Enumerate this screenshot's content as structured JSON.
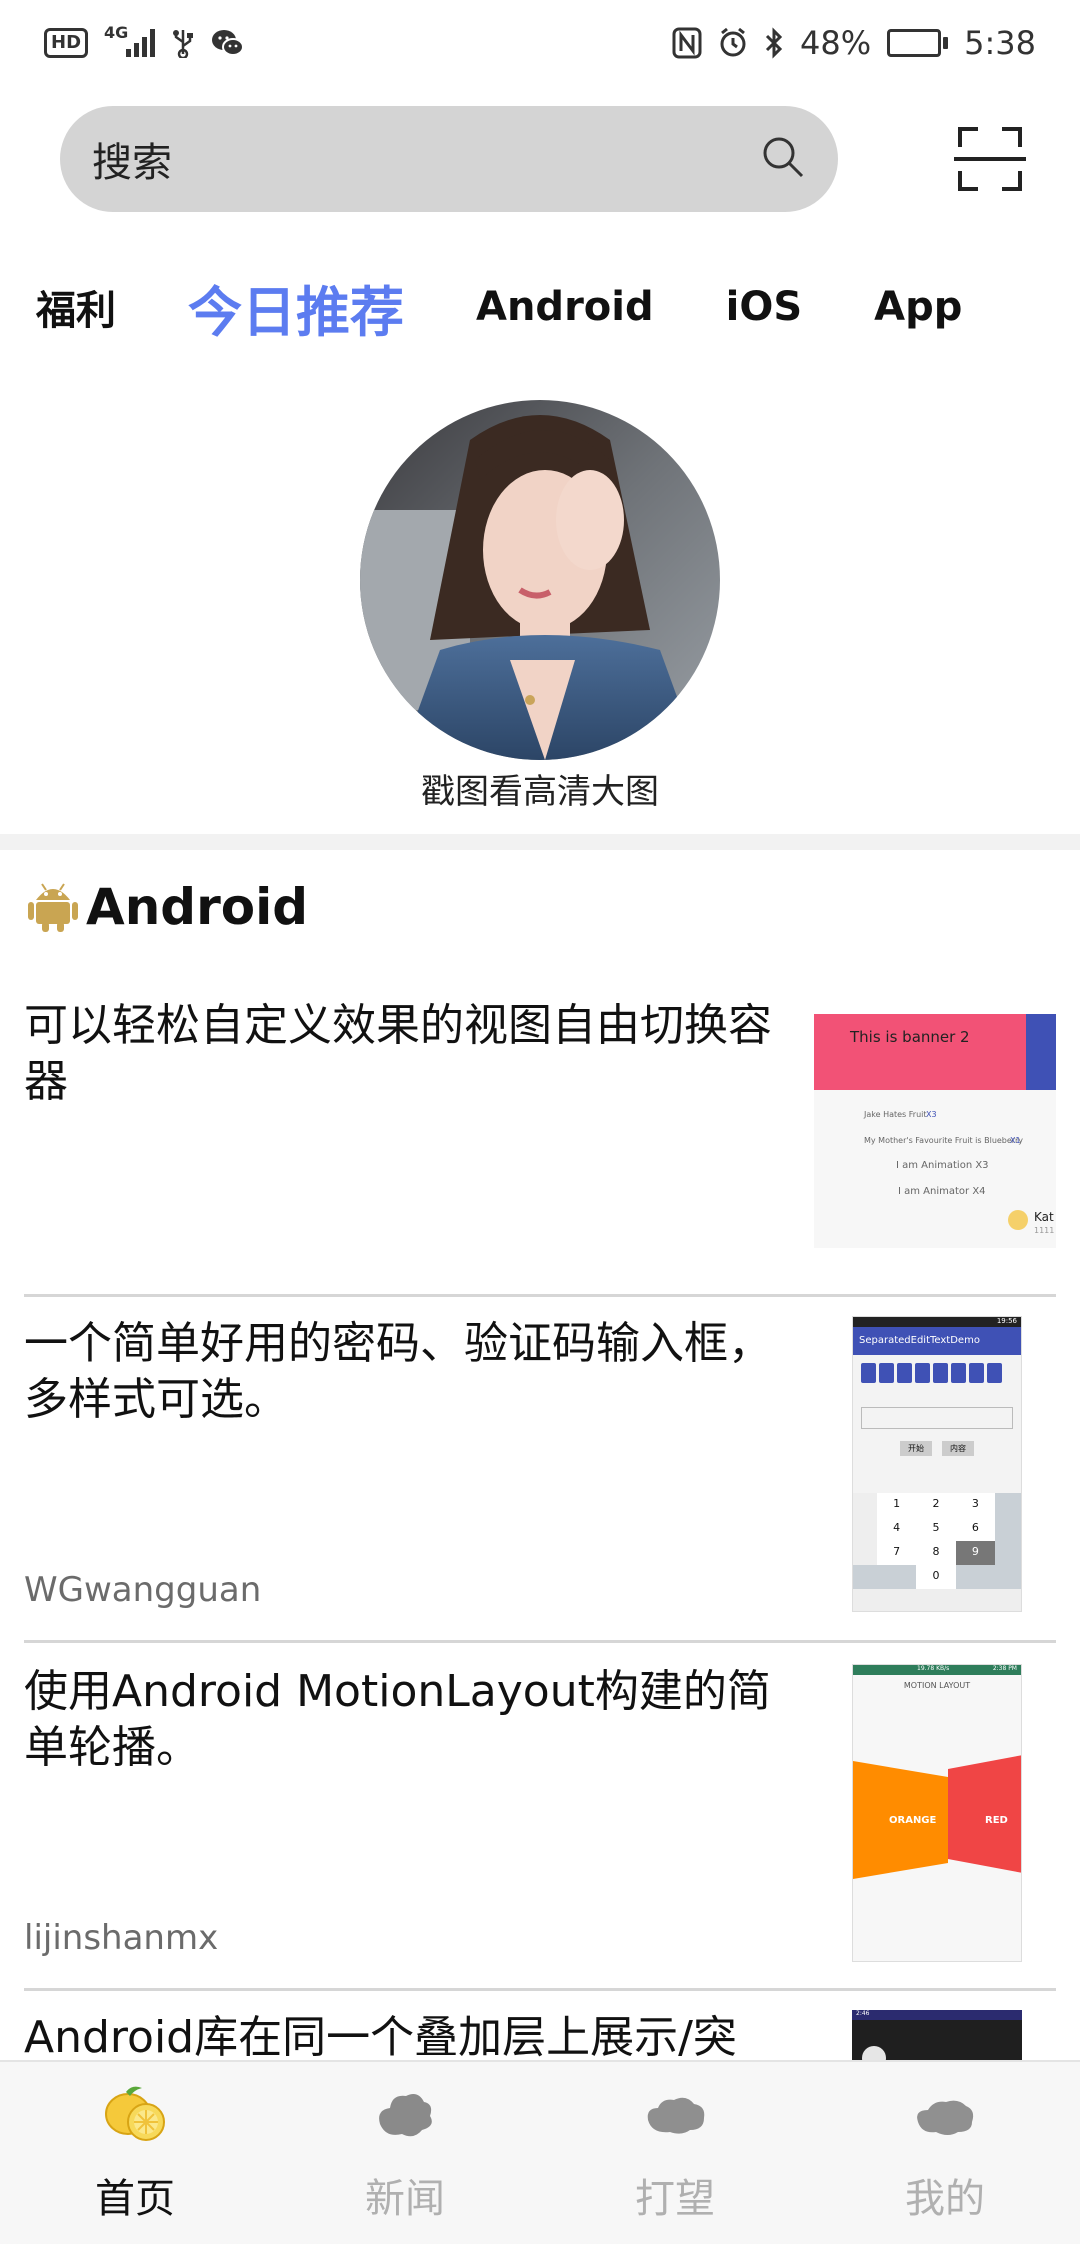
{
  "status_bar": {
    "network_type": "4G",
    "hd_label": "HD",
    "battery_percent": "48%",
    "time": "5:38",
    "battery_level": 0.48
  },
  "search": {
    "placeholder": "搜索"
  },
  "tabs": [
    {
      "label": "福利",
      "active": false
    },
    {
      "label": "今日推荐",
      "active": true
    },
    {
      "label": "Android",
      "active": false
    },
    {
      "label": "iOS",
      "active": false
    },
    {
      "label": "App",
      "active": false
    }
  ],
  "hero": {
    "caption": "戳图看高清大图"
  },
  "section": {
    "title": "Android",
    "icon": "android-robot-icon",
    "icon_color": "#c9a552"
  },
  "articles": [
    {
      "title": "可以轻松自定义效果的视图自由切换容器",
      "author": "",
      "thumb": {
        "banner_text": "This is banner 2",
        "rows": [
          "Jake Hates Fruit",
          "X3",
          "My Mother's Favourite Fruit is Blueberry",
          "X1",
          "I am Animation X3",
          "I am Animator X4"
        ],
        "corner": "Kat",
        "corner_sub": "1111"
      }
    },
    {
      "title": "一个简单好用的密码、验证码输入框，多样式可选。",
      "author": "WGwangguan",
      "thumb": {
        "app_title": "SeparatedEditTextDemo",
        "time": "19:56",
        "btn1": "开始",
        "btn2": "内容",
        "keys": [
          "1",
          "2",
          "3",
          "4",
          "5",
          "6",
          "7",
          "8",
          "9",
          "0"
        ]
      }
    },
    {
      "title": "使用Android MotionLayout构建的简单轮播。",
      "author": "lijinshanmx",
      "thumb": {
        "status": "19.78 KB/s",
        "time": "2:38 PM",
        "header": "MOTION LAYOUT",
        "left_label": "ORANGE",
        "right_label": "RED"
      }
    },
    {
      "title": "Android库在同一个叠加层上展示/突",
      "author": "",
      "thumb": {
        "time": "2:46"
      }
    }
  ],
  "bottom_nav": [
    {
      "label": "首页",
      "icon": "lemon-icon",
      "active": true
    },
    {
      "label": "新闻",
      "icon": "cloud-news-icon",
      "active": false
    },
    {
      "label": "打望",
      "icon": "cloud-watch-icon",
      "active": false
    },
    {
      "label": "我的",
      "icon": "cloud-profile-icon",
      "active": false
    }
  ],
  "colors": {
    "accent": "#5c7cf0",
    "search_bg": "#d4d4d4",
    "inactive_nav": "#b0b0b0",
    "lemon": "#f5c93a"
  }
}
